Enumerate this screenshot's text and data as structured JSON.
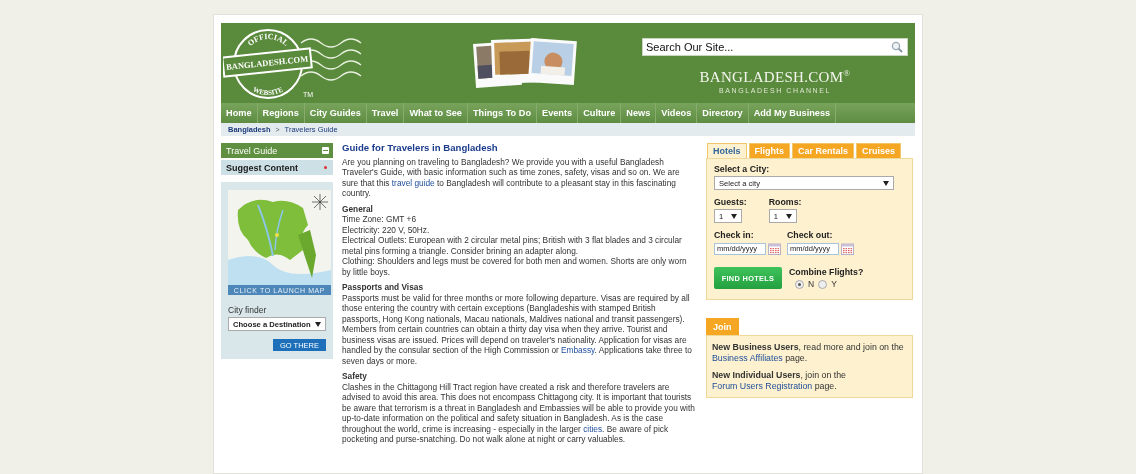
{
  "logo": {
    "top": "OFFICIAL",
    "name": "BANGLADESH.COM",
    "bottom": "WEBSITE",
    "tm": "TM"
  },
  "search": {
    "placeholder": "Search Our Site..."
  },
  "brand": {
    "name": "BANGLADESH.COM",
    "mark": "®",
    "tagline": "BANGLADESH CHANNEL"
  },
  "nav": [
    "Home",
    "Regions",
    "City Guides",
    "Travel",
    "What to See",
    "Things To Do",
    "Events",
    "Culture",
    "News",
    "Videos",
    "Directory",
    "Add My Business"
  ],
  "breadcrumb": [
    {
      "label": "Bangladesh",
      "current": false
    },
    {
      "label": "Travelers Guide",
      "current": true
    }
  ],
  "breadcrumb_separator": ">",
  "sidebar": {
    "menu": [
      {
        "label": "Travel Guide",
        "expanded": true
      },
      {
        "label": "Suggest Content",
        "expanded": false
      }
    ],
    "map_button": "CLICK TO LAUNCH MAP",
    "city_finder_label": "City finder",
    "city_select": "Choose a Destination",
    "go_button": "GO THERE"
  },
  "article": {
    "title": "Guide for Travelers in Bangladesh",
    "sections": [
      {
        "lines": [
          [
            {
              "kind": "text",
              "text": "Are you planning on traveling to Bangladesh? We provide you with a useful Bangladesh Traveler's Guide, with basic information such as time zones, safety, visas and so on. We are sure that this "
            },
            {
              "kind": "link",
              "text": "travel guide"
            },
            {
              "kind": "text",
              "text": " to Bangladesh will contribute to a pleasant stay in this fascinating country."
            }
          ]
        ]
      },
      {
        "heading": "General",
        "lines": [
          [
            {
              "kind": "text",
              "text": "Time Zone: GMT +6"
            }
          ],
          [
            {
              "kind": "text",
              "text": "Electricity: 220 V, 50Hz."
            }
          ],
          [
            {
              "kind": "text",
              "text": "Electrical Outlets: European with 2 circular metal pins; British with 3 flat blades and 3 circular metal pins forming a triangle. Consider brining an adapter along."
            }
          ],
          [
            {
              "kind": "text",
              "text": "Clothing: Shoulders and legs must be covered for both men and women. Shorts are only worn by little boys."
            }
          ]
        ]
      },
      {
        "heading": "Passports and Visas",
        "lines": [
          [
            {
              "kind": "text",
              "text": "Passports must be valid for three months or more following departure. Visas are required by all those entering the country with certain exceptions (Bangladeshis with stamped British passports, Hong Kong nationals, Macau nationals, Maldives national and transit passengers). Members from certain countries can obtain a thirty day visa when they arrive. Tourist and business visas are issued. Prices will depend on traveler's nationality. Application for visas are handled by the consular section of the High Commission or "
            },
            {
              "kind": "link",
              "text": "Embassy"
            },
            {
              "kind": "text",
              "text": ". Applications take three to seven days or more."
            }
          ]
        ]
      },
      {
        "heading": "Safety",
        "lines": [
          [
            {
              "kind": "text",
              "text": "Clashes in the Chittagong Hill Tract region have created a risk and therefore travelers are advised to avoid this area. This does not encompass Chittagong city. It is important that tourists be aware that terrorism is a threat in Bangladesh and Embassies will be able to provide you with up-to-date information on the political and safety situation in Bangladesh. As is the case throughout the world, crime is increasing - especially in the larger "
            },
            {
              "kind": "link",
              "text": "cities"
            },
            {
              "kind": "text",
              "text": ". Be aware of pick pocketing and purse-snatching. Do not walk alone at night or carry valuables."
            }
          ]
        ]
      }
    ]
  },
  "booking": {
    "tabs": [
      {
        "label": "Hotels",
        "selected": true
      },
      {
        "label": "Flights",
        "selected": false
      },
      {
        "label": "Car Rentals",
        "selected": false
      },
      {
        "label": "Cruises",
        "selected": false
      }
    ],
    "city_label": "Select a City:",
    "city_value": "Select a city",
    "guests_label": "Guests:",
    "guests_value": "1",
    "rooms_label": "Rooms:",
    "rooms_value": "1",
    "checkin_label": "Check in:",
    "checkin_placeholder": "mm/dd/yyyy",
    "checkout_label": "Check out:",
    "checkout_placeholder": "mm/dd/yyyy",
    "find_button": "FIND HOTELS",
    "combine_label": "Combine Flights?",
    "combine_options": [
      {
        "label": "N",
        "selected": true
      },
      {
        "label": "Y",
        "selected": false
      }
    ]
  },
  "join": {
    "tab": "Join",
    "paragraphs": [
      [
        {
          "kind": "bold",
          "text": "New Business Users"
        },
        {
          "kind": "text",
          "text": ", read more and join on the "
        },
        {
          "kind": "link",
          "text": "Business Affiliates"
        },
        {
          "kind": "text",
          "text": " page."
        }
      ],
      [
        {
          "kind": "bold",
          "text": "New Individual Users"
        },
        {
          "kind": "text",
          "text": ", join on the "
        },
        {
          "kind": "link",
          "text": "Forum Users Registration"
        },
        {
          "kind": "text",
          "text": " page."
        }
      ]
    ]
  }
}
